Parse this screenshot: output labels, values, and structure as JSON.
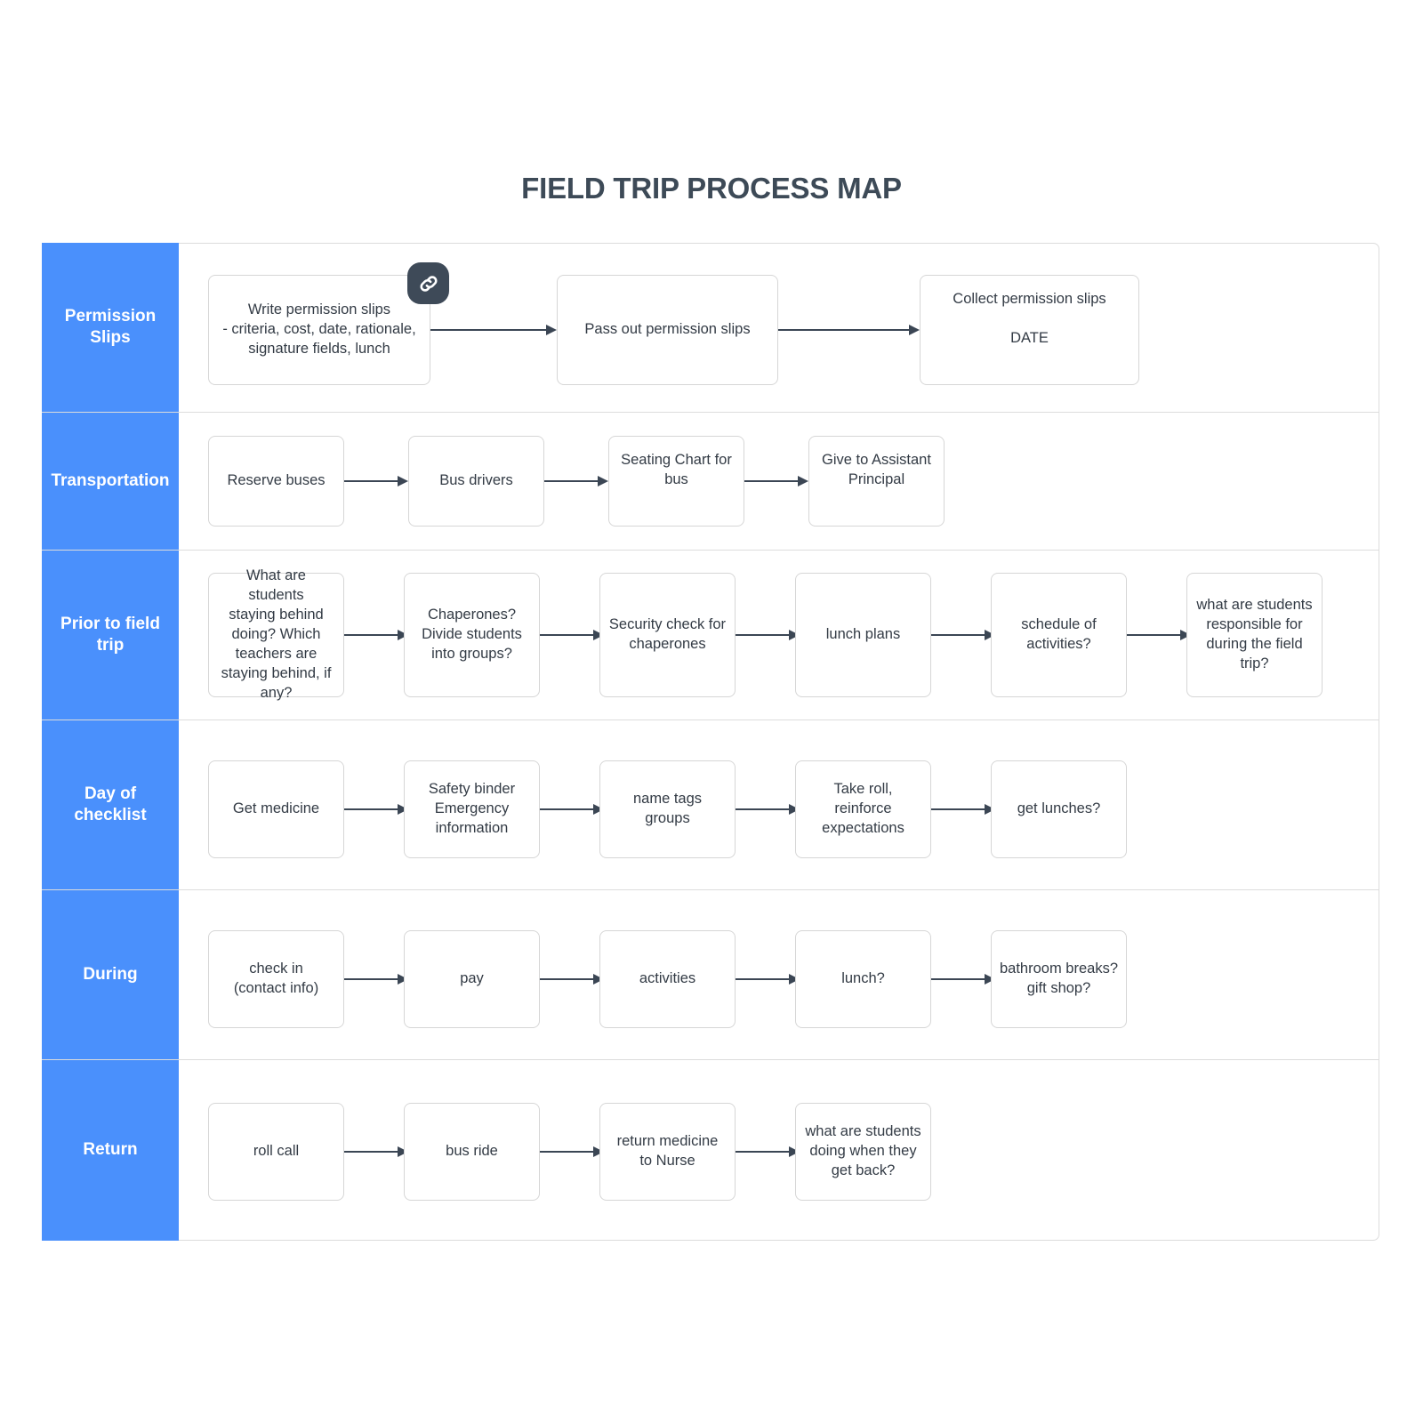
{
  "title": "FIELD TRIP PROCESS MAP",
  "colors": {
    "lane_blue": "#4a90fc",
    "text_dark": "#333b45",
    "title_dark": "#3d4a57",
    "border_gray": "#d6d6d6",
    "frame_gray": "#dcdcdc",
    "badge_dark": "#3e4a58",
    "arrow_dark": "#3b4654"
  },
  "badge": {
    "icon": "link-icon",
    "attached_to": "Write permission slips - criteria, cost, date, rationale, signature fields, lunch"
  },
  "lanes": [
    {
      "label": "Permission\nSlips",
      "nodes": [
        "Write permission slips\n- criteria, cost, date, rationale,\nsignature fields, lunch",
        "Pass out permission slips",
        "Collect permission slips\n\nDATE"
      ]
    },
    {
      "label": "Transportation",
      "nodes": [
        "Reserve buses",
        "Bus drivers",
        "Seating Chart for\nbus",
        "Give to Assistant\nPrincipal"
      ]
    },
    {
      "label": "Prior to\nfield trip",
      "nodes": [
        "What are students\nstaying behind\ndoing? Which\nteachers are\nstaying behind, if\nany?",
        "Chaperones?\nDivide students\ninto groups?",
        "Security check for\nchaperones",
        "lunch plans",
        "schedule of\nactivities?",
        "what are students\nresponsible for\nduring the field\ntrip?"
      ]
    },
    {
      "label": "Day of\nchecklist",
      "nodes": [
        "Get medicine",
        "Safety binder\nEmergency\ninformation",
        "name tags\ngroups",
        "Take roll,\nreinforce\nexpectations",
        "get lunches?"
      ]
    },
    {
      "label": "During",
      "nodes": [
        "check in\n(contact info)",
        "pay",
        "activities",
        "lunch?",
        "bathroom breaks?\ngift shop?"
      ]
    },
    {
      "label": "Return",
      "nodes": [
        "roll call",
        "bus ride",
        "return medicine\nto Nurse",
        "what are students\ndoing when they\nget back?"
      ]
    }
  ]
}
